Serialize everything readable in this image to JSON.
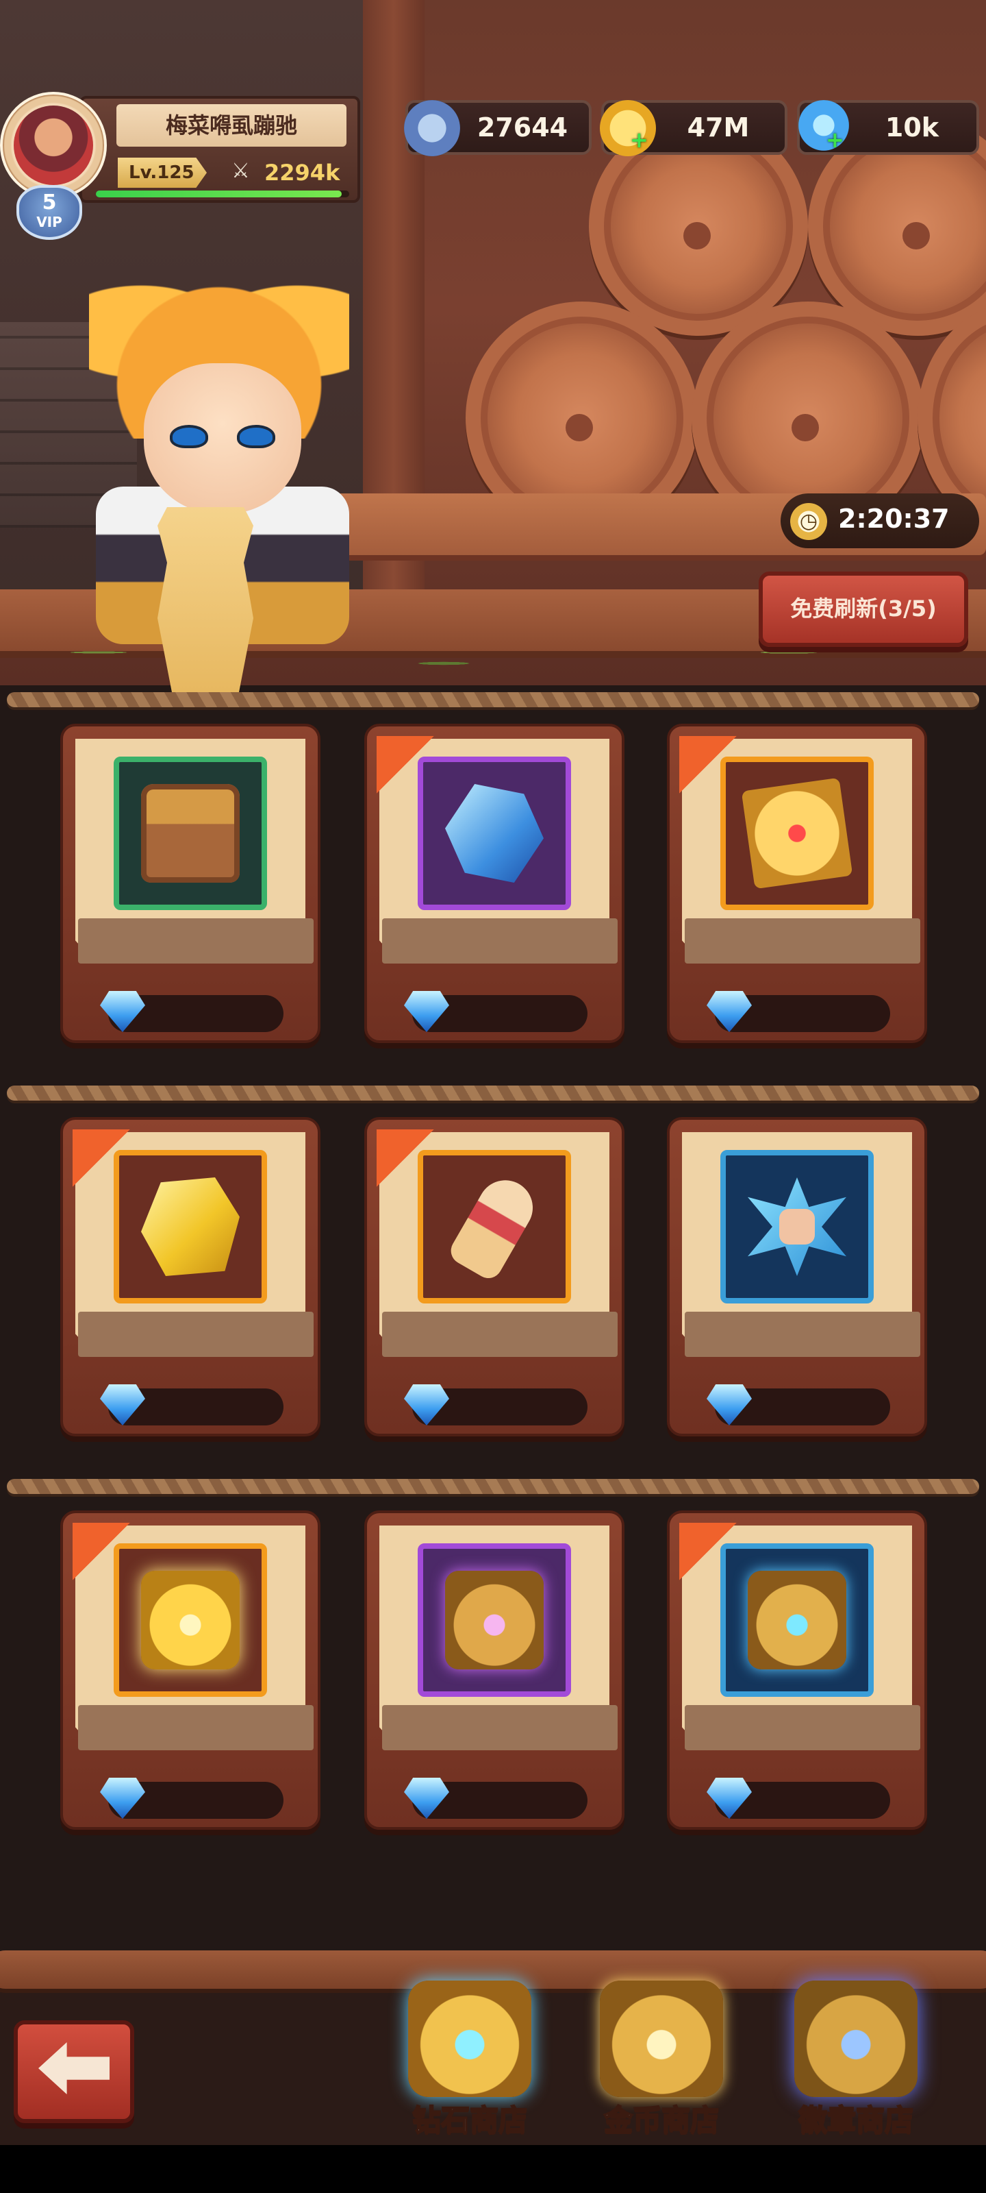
{
  "player": {
    "name": "梅菜嘚虱蹦驰",
    "level": "Lv.125",
    "power": "2294k",
    "vip_level": "5",
    "vip_label": "VIP",
    "exp_progress": 0.97
  },
  "currencies": [
    {
      "name": "combat-power",
      "icon": "crossed-swords-icon",
      "value": "27644"
    },
    {
      "name": "gold",
      "icon": "gold-coin-icon",
      "value": "47M"
    },
    {
      "name": "diamond",
      "icon": "diamond-icon",
      "value": "10k"
    }
  ],
  "shop": {
    "timer": "2:20:37",
    "refresh_label": "免费刷新(3/5)",
    "items": [
      {
        "icon": "treasure-chest-icon",
        "rarity": "green",
        "discount": false
      },
      {
        "icon": "blue-crystal-icon",
        "rarity": "purple",
        "discount": true
      },
      {
        "icon": "golden-spellbook-icon",
        "rarity": "orange",
        "discount": true
      },
      {
        "icon": "gold-ore-icon",
        "rarity": "orange",
        "discount": true
      },
      {
        "icon": "red-scroll-icon",
        "rarity": "orange",
        "discount": true
      },
      {
        "icon": "fist-skill-icon",
        "rarity": "blue",
        "discount": false
      },
      {
        "icon": "golden-chest-icon",
        "rarity": "orange",
        "discount": true
      },
      {
        "icon": "purple-skull-chest-icon",
        "rarity": "purple",
        "discount": false
      },
      {
        "icon": "blue-cloud-chest-icon",
        "rarity": "blue",
        "discount": true
      }
    ]
  },
  "tabs": [
    {
      "label": "钻石商店",
      "icon": "diamond-chest-icon"
    },
    {
      "label": "金币商店",
      "icon": "gold-chest-icon"
    },
    {
      "label": "徽章商店",
      "icon": "badge-chest-icon"
    }
  ],
  "colors": {
    "discount_corner": "#f0622c",
    "refresh_button": "#c0443a",
    "exp_bar": "#3ad04b"
  }
}
